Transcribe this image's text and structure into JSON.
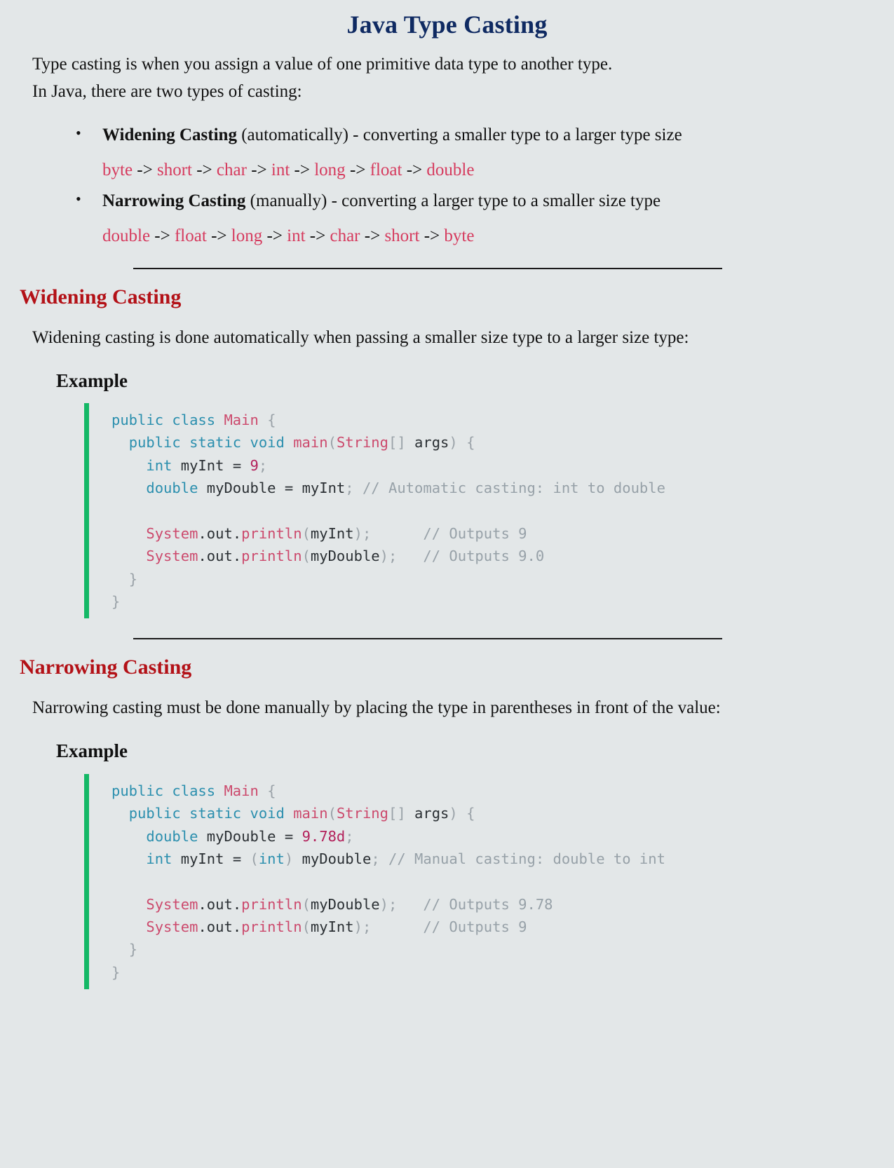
{
  "title": "Java Type Casting",
  "intro": {
    "line1": "Type casting is when you assign a value of one primitive data type to another type.",
    "line2": "In Java, there are two types of casting:"
  },
  "colors": {
    "background": "#e3e7e8",
    "title": "#0f2a62",
    "section_heading": "#b31117",
    "type_chain": "#d63b5e",
    "code_accent_bar": "#14b866",
    "keyword": "#2b8fae",
    "identifier": "#cc4a6d",
    "comment": "#97a1a8",
    "number": "#b3205a",
    "punctuation": "#9aa2a8"
  },
  "bullets": [
    {
      "term": "Widening Casting",
      "rest": " (automatically) - converting a smaller type to a larger type size",
      "chain": "byte -> short -> char -> int -> long -> float -> double",
      "chain_types": [
        "byte",
        "short",
        "char",
        "int",
        "long",
        "float",
        "double"
      ],
      "chain_arrow": "->"
    },
    {
      "term": "Narrowing Casting",
      "rest": " (manually) - converting a larger type to a smaller size type",
      "chain": "double -> float -> long -> int -> char -> short -> byte",
      "chain_types": [
        "double",
        "float",
        "long",
        "int",
        "char",
        "short",
        "byte"
      ],
      "chain_arrow": "->"
    }
  ],
  "sections": [
    {
      "heading": "Widening Casting",
      "description": "Widening casting is done automatically when passing a smaller size type to a larger size type:",
      "example_label": "Example",
      "code_lines": [
        "public class Main {",
        "  public static void main(String[] args) {",
        "    int myInt = 9;",
        "    double myDouble = myInt; // Automatic casting: int to double",
        "",
        "    System.out.println(myInt);      // Outputs 9",
        "    System.out.println(myDouble);   // Outputs 9.0",
        "  }",
        "}"
      ]
    },
    {
      "heading": "Narrowing Casting",
      "description": "Narrowing casting must be done manually by placing the type in parentheses in front of the value:",
      "example_label": "Example",
      "code_lines": [
        "public class Main {",
        "  public static void main(String[] args) {",
        "    double myDouble = 9.78d;",
        "    int myInt = (int) myDouble; // Manual casting: double to int",
        "",
        "    System.out.println(myDouble);   // Outputs 9.78",
        "    System.out.println(myInt);      // Outputs 9",
        "  }",
        "}"
      ]
    }
  ]
}
